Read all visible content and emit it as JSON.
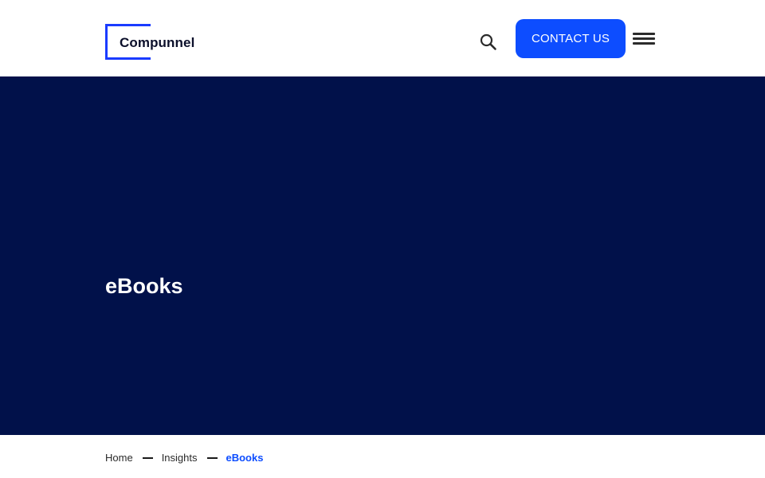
{
  "header": {
    "logo_text": "Compunnel",
    "contact_label": "CONTACT US"
  },
  "hero": {
    "title": "eBooks"
  },
  "breadcrumb": {
    "items": [
      "Home",
      "Insights"
    ],
    "current": "eBooks"
  },
  "icons": {
    "search": "search-icon",
    "menu": "hamburger-menu-icon"
  },
  "colors": {
    "brand_blue": "#0d4dff",
    "logo_blue": "#1a3bff",
    "hero_bg": "#01114a",
    "current_crumb": "#0d4dff"
  }
}
